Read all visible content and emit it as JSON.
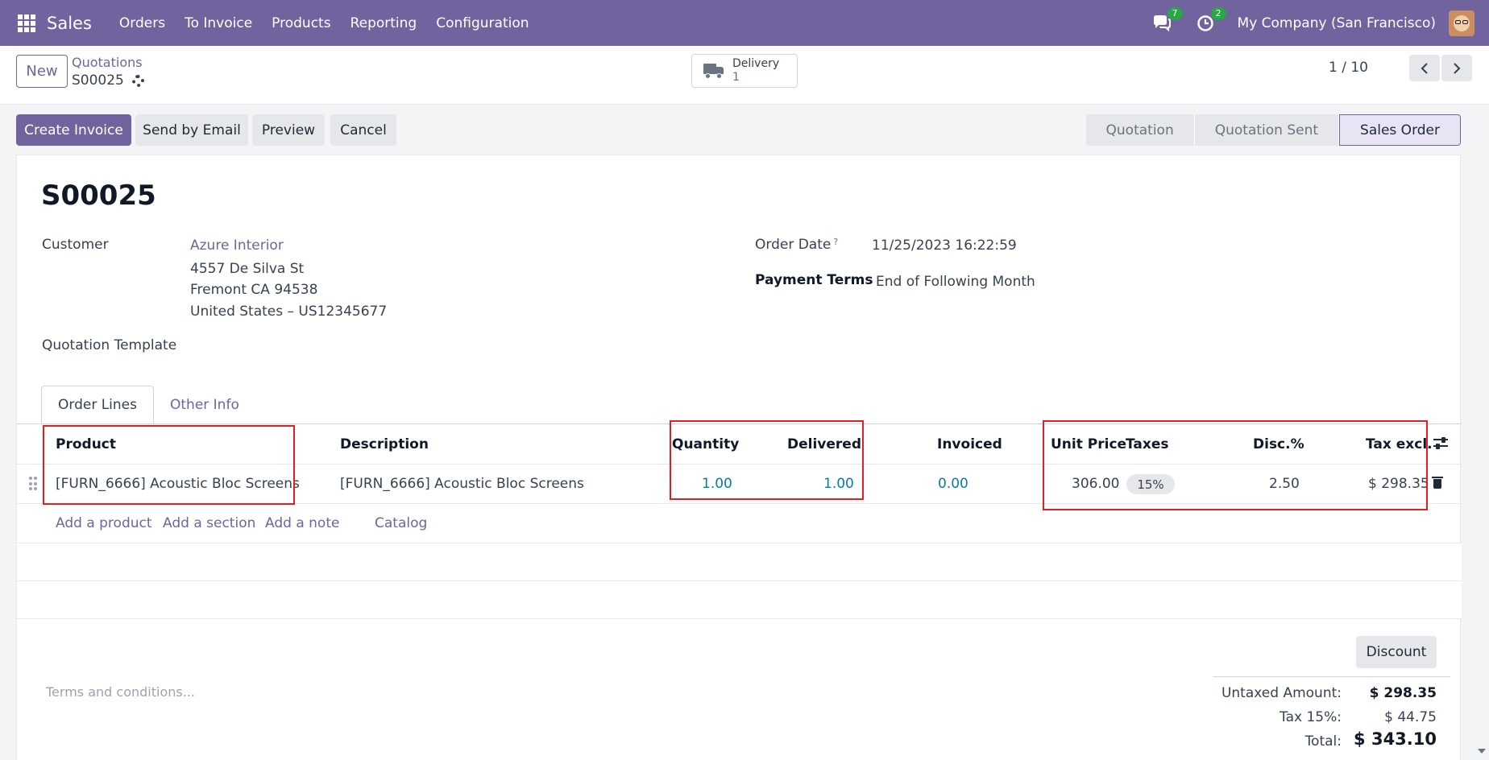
{
  "app": {
    "name": "Sales",
    "menu": [
      "Orders",
      "To Invoice",
      "Products",
      "Reporting",
      "Configuration"
    ],
    "messages_count": "7",
    "activities_count": "2",
    "company": "My Company (San Francisco)"
  },
  "control": {
    "new_label": "New",
    "breadcrumb_parent": "Quotations",
    "breadcrumb_current": "S00025",
    "delivery_label": "Delivery",
    "delivery_count": "1",
    "pager": "1 / 10"
  },
  "actions": {
    "create_invoice": "Create Invoice",
    "send_email": "Send by Email",
    "preview": "Preview",
    "cancel": "Cancel"
  },
  "status_stages": [
    "Quotation",
    "Quotation Sent",
    "Sales Order"
  ],
  "status_active": "Sales Order",
  "form": {
    "title": "S00025",
    "customer_label": "Customer",
    "customer_name": "Azure Interior",
    "address_line1": "4557 De Silva St",
    "address_line2": "Fremont CA 94538",
    "address_line3": "United States – US12345677",
    "quotation_template_label": "Quotation Template",
    "order_date_label": "Order Date",
    "order_date_help": "?",
    "order_date": "11/25/2023 16:22:59",
    "payment_terms_label": "Payment Terms",
    "payment_terms": "End of Following Month"
  },
  "tabs": [
    "Order Lines",
    "Other Info"
  ],
  "table": {
    "headers": {
      "product": "Product",
      "description": "Description",
      "quantity": "Quantity",
      "delivered": "Delivered",
      "invoiced": "Invoiced",
      "unit_price": "Unit Price",
      "taxes": "Taxes",
      "discount": "Disc.%",
      "subtotal": "Tax excl."
    },
    "rows": [
      {
        "product": "[FURN_6666] Acoustic Bloc Screens",
        "description": "[FURN_6666] Acoustic Bloc Screens",
        "quantity": "1.00",
        "delivered": "1.00",
        "invoiced": "0.00",
        "unit_price": "306.00",
        "taxes": "15%",
        "discount": "2.50",
        "subtotal": "$ 298.35"
      }
    ],
    "add_product": "Add a product",
    "add_section": "Add a section",
    "add_note": "Add a note",
    "catalog": "Catalog"
  },
  "footer": {
    "terms_placeholder": "Terms and conditions...",
    "discount_button": "Discount",
    "untaxed_label": "Untaxed Amount:",
    "untaxed_value": "$ 298.35",
    "tax_label": "Tax 15%:",
    "tax_value": "$ 44.75",
    "total_label": "Total:",
    "total_value": "$ 343.10"
  },
  "colors": {
    "brand": "#71639e",
    "link_numbers": "#0b7c99",
    "highlight_box": "#e02020"
  }
}
